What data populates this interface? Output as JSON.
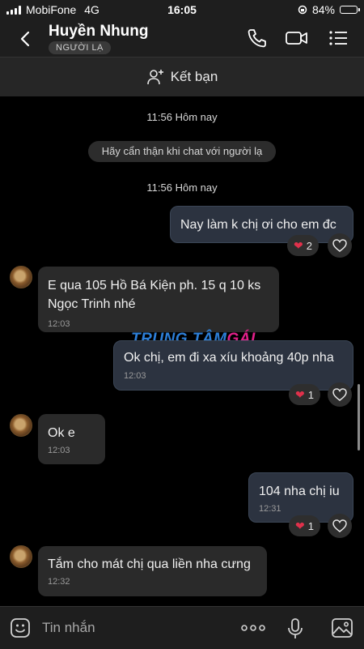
{
  "status_bar": {
    "carrier": "MobiFone",
    "network": "4G",
    "time": "16:05",
    "battery": "84%",
    "battery_level": 0.84
  },
  "header": {
    "contact_name": "Huyền Nhung",
    "badge": "NGƯỜI LẠ",
    "icons": [
      "back-icon",
      "phone-icon",
      "video-call-icon",
      "menu-list-icon"
    ]
  },
  "add_friend": {
    "label": "Kết bạn",
    "icon": "add-person-icon"
  },
  "conversation": {
    "timestamp_1": "11:56 Hôm nay",
    "system_notice": "Hãy cẩn thận khi chat với người lạ",
    "timestamp_2": "11:56 Hôm nay",
    "messages": [
      {
        "sender": "me",
        "text": "Nay làm k chị ơi cho em đc",
        "reaction_count": "2"
      },
      {
        "sender": "them",
        "text": "E qua 105 Hồ Bá Kiện ph. 15 q 10 ks\nNgọc Trinh nhé",
        "time": "12:03"
      },
      {
        "sender": "me",
        "text": "Ok chị, em đi xa xíu khoảng 40p nha",
        "time": "12:03",
        "reaction_count": "1"
      },
      {
        "sender": "them",
        "text": "Ok e",
        "time": "12:03"
      },
      {
        "sender": "me",
        "text": "104 nha chị iu",
        "time": "12:31",
        "reaction_count": "1"
      },
      {
        "sender": "them",
        "text": "Tắm cho mát chị qua liền nha cưng",
        "time": "12:32"
      }
    ]
  },
  "watermark": {
    "part1": "TRUNG TÂM",
    "part2": "GÁI"
  },
  "input": {
    "placeholder": "Tin nhắn",
    "icons": [
      "sticker-icon",
      "more-icon",
      "microphone-icon",
      "image-icon"
    ]
  },
  "colors": {
    "background": "#000000",
    "bar": "#1e1e1e",
    "incoming_bubble": "#2a2a2a",
    "outgoing_bubble": "#2c3340",
    "heart": "#e0314b"
  }
}
